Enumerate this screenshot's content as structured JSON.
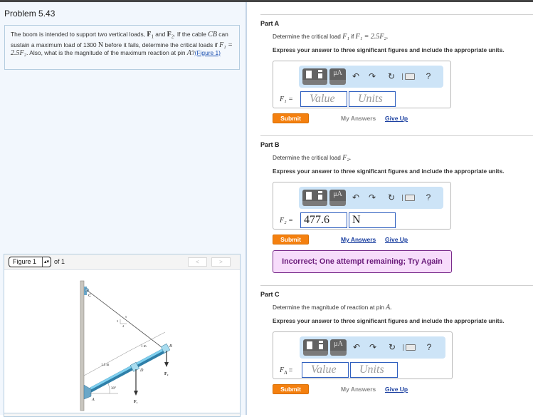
{
  "problem": {
    "title": "Problem 5.43",
    "statement": {
      "t1": "The boom is intended to support two vertical loads, ",
      "F1": "F",
      "F1sub": "1",
      "and": " and ",
      "F2": "F",
      "F2sub": "2",
      "t2": ". If the cable ",
      "CB": "CB",
      "t3": " can sustain a maximum load of 1300 ",
      "N": "N",
      "t4": " before it fails, determine the critical loads if ",
      "eq": "F₁ = 2.5F₂",
      "t5": ". Also, what is the magnitude of the maximum reaction at pin ",
      "A": "A",
      "t6": "?",
      "figure_link": "(Figure 1)"
    }
  },
  "figure_panel": {
    "select_value": "Figure 1",
    "of_label": "of 1",
    "prev_label": "<",
    "next_label": ">",
    "labels": {
      "C": "C",
      "B": "B",
      "D": "D",
      "A": "A",
      "F1": "F₁",
      "F2": "F₂",
      "len_1m": "1 m",
      "len_15m": "1.5 m",
      "angle": "30°",
      "slope_3": "3",
      "slope_4": "4",
      "slope_5": "5"
    }
  },
  "parts": [
    {
      "title": "Part A",
      "question": "Determine the critical load ",
      "question_math": "F₁",
      "question_tail": " if ",
      "question_math2": "F₁ = 2.5F₂.",
      "instruction": "Express your answer to three significant figures and include the appropriate units.",
      "label": "F₁ =",
      "value": "",
      "value_placeholder": "Value",
      "units": "",
      "units_placeholder": "Units",
      "submit": "Submit",
      "my_answers": "My Answers",
      "give_up": "Give Up"
    },
    {
      "title": "Part B",
      "question": "Determine the critical load ",
      "question_math": "F₂.",
      "instruction": "Express your answer to three significant figures and include the appropriate units.",
      "label": "F₂ =",
      "value": "477.6",
      "units": "N",
      "submit": "Submit",
      "my_answers": "My Answers",
      "give_up": "Give Up",
      "feedback": "Incorrect; One attempt remaining; Try Again"
    },
    {
      "title": "Part C",
      "question": "Determine the magnitude of reaction at pin ",
      "question_math": "A.",
      "instruction": "Express your answer to three significant figures and include the appropriate units.",
      "label": "F_A =",
      "label_main": "F",
      "label_sub": "A",
      "label_eq": " =",
      "value": "",
      "value_placeholder": "Value",
      "units": "",
      "units_placeholder": "Units",
      "submit": "Submit",
      "my_answers": "My Answers",
      "give_up": "Give Up"
    }
  ],
  "toolbar": {
    "templates": "templates-icon",
    "units_symbol": "μA",
    "undo": "↶",
    "redo": "↷",
    "reset": "↻",
    "keyboard": "keyboard-icon",
    "help": "?"
  },
  "colors": {
    "submit": "#f4800f",
    "feedback_bg": "#f7dcfb",
    "feedback_border": "#7a2c8c",
    "link": "#1a3fa0",
    "toolbar_bg": "#cde4f7"
  }
}
